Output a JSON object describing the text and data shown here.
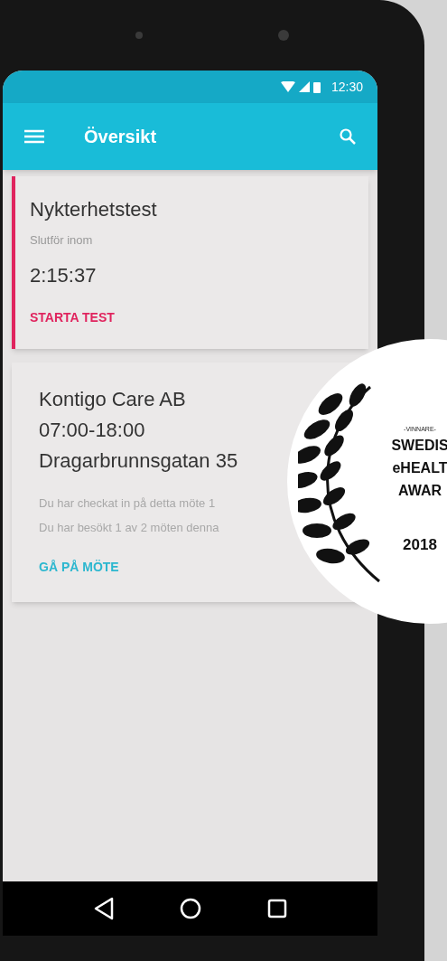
{
  "status_bar": {
    "time": "12:30"
  },
  "app_bar": {
    "title": "Översikt"
  },
  "cards": [
    {
      "kind": "test",
      "title": "Nykterhetstest",
      "caption": "Slutför inom",
      "countdown": "2:15:37",
      "action": "STARTA TEST"
    },
    {
      "kind": "meeting",
      "lines": [
        "Kontigo Care AB",
        "07:00-18:00",
        "Dragarbrunnsgatan 35"
      ],
      "notes": [
        "Du har checkat in på detta möte 1",
        "Du har besökt 1 av 2 möten denna"
      ],
      "action": "GÅ PÅ MÖTE"
    }
  ],
  "award_badge": {
    "overline": "-VINNARE-",
    "lines": [
      "SWEDIS",
      "eHEALT",
      "AWAR"
    ],
    "year": "2018"
  }
}
